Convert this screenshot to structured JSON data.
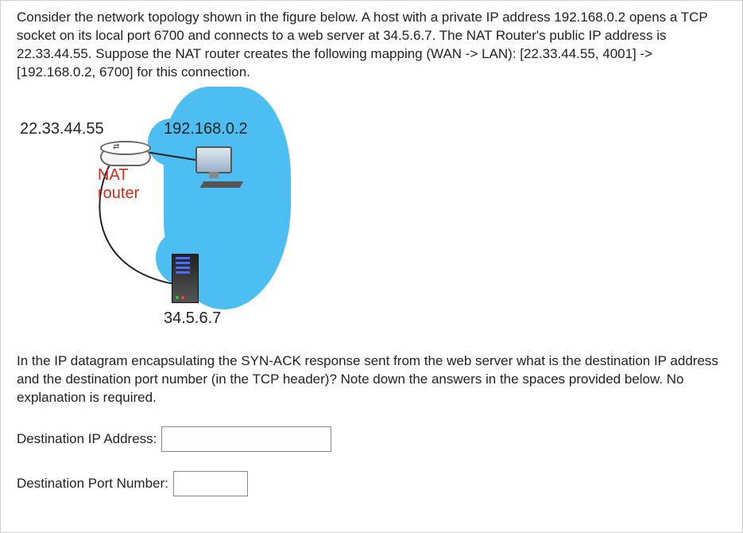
{
  "question": {
    "intro": "Consider the network topology shown in the figure below. A host with a private IP address 192.168.0.2 opens a TCP socket on its local port 6700 and connects to a web server at 34.5.6.7. The NAT Router's public IP address is 22.33.44.55. Suppose the NAT router creates the following mapping (WAN -> LAN): [22.33.44.55, 4001] -> [192.168.0.2, 6700] for this connection.",
    "followup": "In the IP datagram encapsulating the SYN-ACK response sent from the web server what is the destination IP address and the destination port number (in the TCP header)? Note down the answers in the spaces provided below. No explanation is required."
  },
  "diagram": {
    "nat_public_ip": "22.33.44.55",
    "host_private_ip": "192.168.0.2",
    "nat_label_line1": "NAT",
    "nat_label_line2": "router",
    "server_ip": "34.5.6.7"
  },
  "inputs": {
    "dest_ip_label": "Destination IP Address:",
    "dest_ip_value": "",
    "dest_port_label": "Destination Port Number:",
    "dest_port_value": ""
  }
}
